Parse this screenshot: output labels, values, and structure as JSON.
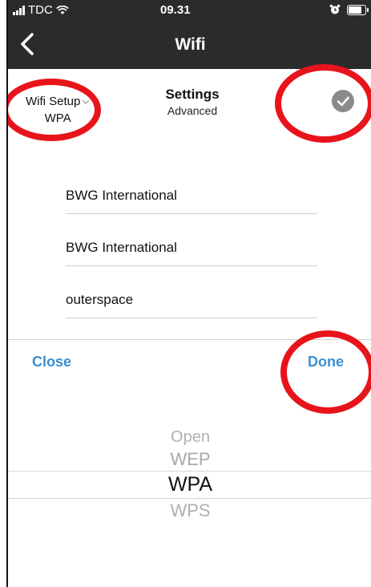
{
  "status_bar": {
    "carrier": "TDC",
    "time": "09.31"
  },
  "navbar": {
    "title": "Wifi"
  },
  "header": {
    "setup_label": "Wifi Setup",
    "setup_value": "WPA",
    "settings_label": "Settings",
    "settings_sub": "Advanced"
  },
  "fields": {
    "field1": "BWG International",
    "field2": "BWG International",
    "field3": "outerspace"
  },
  "actions": {
    "close": "Close",
    "done": "Done"
  },
  "picker": {
    "options": [
      "Open",
      "WEP",
      "WPA",
      "WPS"
    ],
    "selected": "WPA"
  },
  "colors": {
    "nav_bg": "#2b2b2b",
    "accent": "#3a8fd0",
    "annotation": "#e8141b"
  }
}
